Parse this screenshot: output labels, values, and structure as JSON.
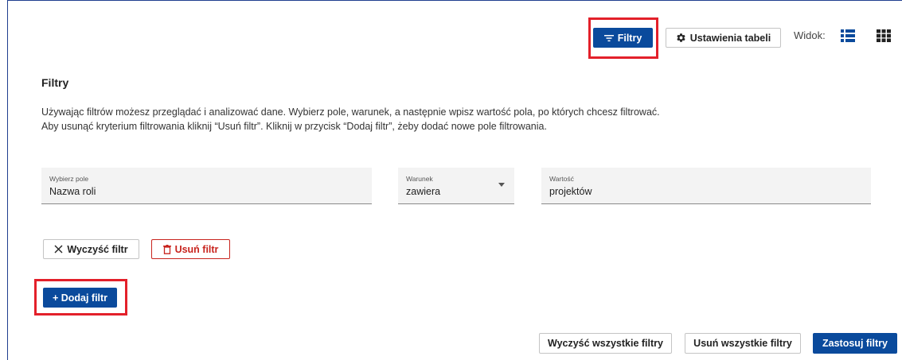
{
  "toolbar": {
    "filters_label": "Filtry",
    "table_settings_label": "Ustawienia tabeli",
    "view_label": "Widok:"
  },
  "panel": {
    "title": "Filtry",
    "description_line1": "Używając filtrów możesz przeglądać i analizować dane. Wybierz pole, warunek, a następnie wpisz wartość pola, po których chcesz filtrować.",
    "description_line2": "Aby usunąć kryterium filtrowania kliknij “Usuń filtr”. Kliknij w przycisk “Dodaj filtr”, żeby dodać nowe pole filtrowania."
  },
  "filter_row": {
    "field_label": "Wybierz pole",
    "field_value": "Nazwa roli",
    "condition_label": "Warunek",
    "condition_value": "zawiera",
    "value_label": "Wartość",
    "value_value": "projektów"
  },
  "row_actions": {
    "clear_label": "Wyczyść filtr",
    "remove_label": "Usuń filtr"
  },
  "add_filter_label": "+ Dodaj filtr",
  "footer": {
    "clear_all_label": "Wyczyść wszystkie filtry",
    "remove_all_label": "Usuń wszystkie filtry",
    "apply_label": "Zastosuj filtry"
  },
  "colors": {
    "primary": "#0a4a9c",
    "danger": "#c8241e",
    "highlight": "#e3202a"
  },
  "icons": [
    "filter-icon",
    "gear-icon",
    "list-view-icon",
    "grid-view-icon",
    "close-icon",
    "trash-icon"
  ]
}
